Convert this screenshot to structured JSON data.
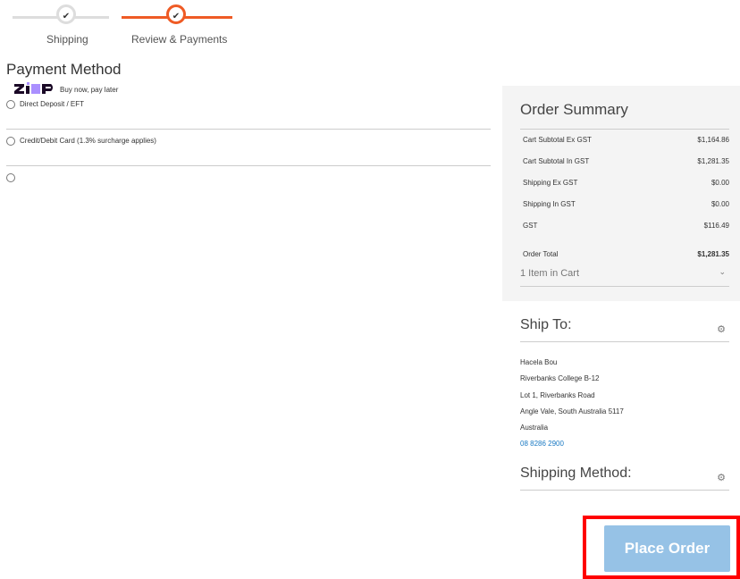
{
  "progress": {
    "steps": [
      {
        "label": "Shipping",
        "state": "complete"
      },
      {
        "label": "Review & Payments",
        "state": "active"
      }
    ],
    "check_glyph": "✔",
    "accent_color": "#ef5b25"
  },
  "payment": {
    "title": "Payment Method",
    "methods": [
      {
        "label": "Direct Deposit / EFT"
      },
      {
        "label": "Credit/Debit Card (1.3% surcharge applies)"
      },
      {
        "label": "Buy now, pay later",
        "logo": "zip-logo"
      }
    ]
  },
  "summary": {
    "title": "Order Summary",
    "rows": [
      {
        "label": "Cart Subtotal Ex GST",
        "value": "$1,164.86"
      },
      {
        "label": "Cart Subtotal In GST",
        "value": "$1,281.35"
      },
      {
        "label": "Shipping Ex GST",
        "value": "$0.00"
      },
      {
        "label": "Shipping In GST",
        "value": "$0.00"
      },
      {
        "label": "GST",
        "value": "$116.49"
      }
    ],
    "total": {
      "label": "Order Total",
      "value": "$1,281.35"
    },
    "items_in_cart": "1 Item in Cart",
    "chevron": "⌄"
  },
  "ship_to": {
    "title": "Ship To:",
    "gear": "⚙",
    "address": {
      "name": "Hacela Bou",
      "line1": "Riverbanks College B-12",
      "line2": "Lot 1, Riverbanks Road",
      "line3": "Angle Vale, South Australia 5117",
      "country": "Australia",
      "phone": "08 8286 2900"
    }
  },
  "shipping_method": {
    "title": "Shipping Method:",
    "gear": "⚙"
  },
  "place_order": {
    "label": "Place Order",
    "color": "#96c2e6",
    "highlight_color": "#ff0000"
  }
}
